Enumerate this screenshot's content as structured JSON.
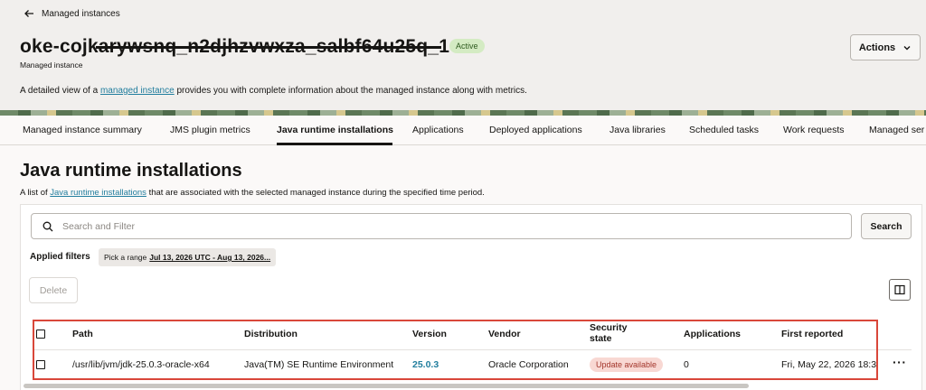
{
  "header": {
    "back_label": "Managed instances",
    "title": "oke-cojkarywsnq_n2djhzvwxza_salbf64u25q_1",
    "status": "Active",
    "subtitle": "Managed instance",
    "description_prefix": "A detailed view of a ",
    "description_link": "managed instance",
    "description_suffix": " provides you with complete information about the managed instance along with metrics.",
    "actions_label": "Actions"
  },
  "tabs": [
    {
      "label": "Managed instance summary"
    },
    {
      "label": "JMS plugin metrics"
    },
    {
      "label": "Java runtime installations"
    },
    {
      "label": "Applications"
    },
    {
      "label": "Deployed applications"
    },
    {
      "label": "Java libraries"
    },
    {
      "label": "Scheduled tasks"
    },
    {
      "label": "Work requests"
    },
    {
      "label": "Managed ser"
    }
  ],
  "section": {
    "title": "Java runtime installations",
    "desc_prefix": "A list of ",
    "desc_link": "Java runtime installations",
    "desc_suffix": " that are associated with the selected managed instance during the specified time period."
  },
  "search": {
    "placeholder": "Search and Filter",
    "button_label": "Search"
  },
  "filters": {
    "label": "Applied filters",
    "chip_prefix": "Pick a range",
    "chip_value": "Jul 13, 2026 UTC - Aug 13, 2026..."
  },
  "toolbar": {
    "delete_label": "Delete"
  },
  "table": {
    "headers": {
      "path": "Path",
      "distribution": "Distribution",
      "version": "Version",
      "vendor": "Vendor",
      "security_line1": "Security",
      "security_line2": "state",
      "applications": "Applications",
      "first_reported": "First reported"
    },
    "rows": [
      {
        "path": "/usr/lib/jvm/jdk-25.0.3-oracle-x64",
        "distribution": "Java(TM) SE Runtime Environment",
        "version": "25.0.3",
        "vendor": "Oracle Corporation",
        "security_state": "Update available",
        "applications": "0",
        "first_reported": "Fri, May 22, 2026 18:3"
      }
    ]
  },
  "colors": {
    "accent_link": "#227e9e",
    "active_badge_bg": "#d4ebc3",
    "update_badge_bg": "#f8d8d3",
    "highlight_border": "#d9473a"
  }
}
